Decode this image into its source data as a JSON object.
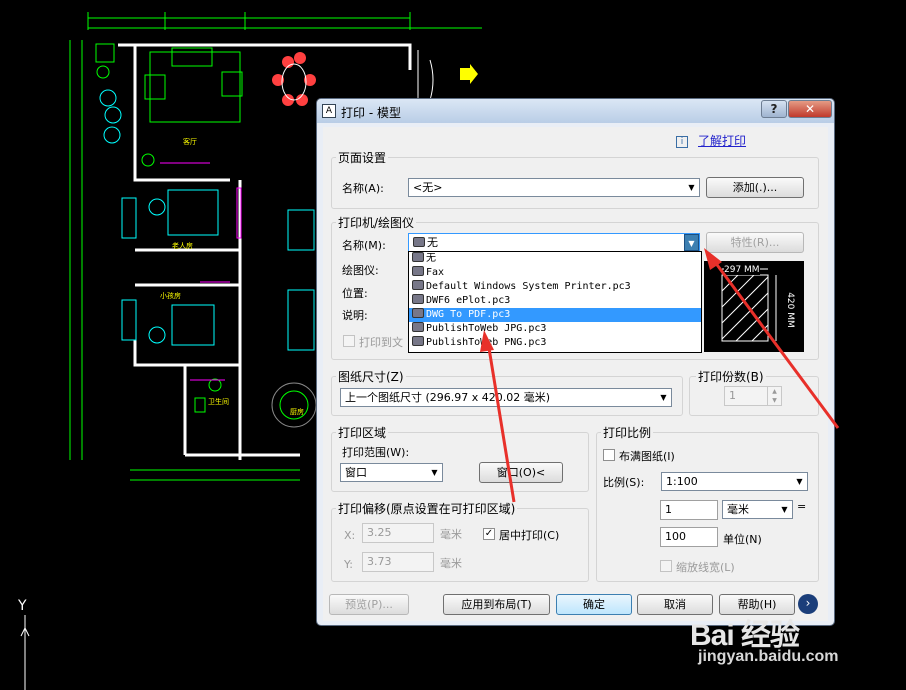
{
  "dialog": {
    "title": "打印 - 模型",
    "help_button": "?",
    "learn_link": "了解打印"
  },
  "page_setup": {
    "legend": "页面设置",
    "name_label": "名称(A):",
    "name_value": "<无>",
    "add_button": "添加(.)..."
  },
  "printer": {
    "legend": "打印机/绘图仪",
    "name_label": "名称(M):",
    "name_value": "无",
    "properties_button": "特性(R)...",
    "plotter_label": "绘图仪:",
    "location_label": "位置:",
    "description_label": "说明:",
    "print_to_file_label": "打印到文",
    "options": [
      {
        "label": "无",
        "selected": false
      },
      {
        "label": "Fax",
        "selected": false
      },
      {
        "label": "Default Windows System Printer.pc3",
        "selected": false
      },
      {
        "label": "DWF6 ePlot.pc3",
        "selected": false
      },
      {
        "label": "DWG To PDF.pc3",
        "selected": true
      },
      {
        "label": "PublishToWeb JPG.pc3",
        "selected": false
      },
      {
        "label": "PublishToWeb PNG.pc3",
        "selected": false
      }
    ],
    "preview_width": "297 MM",
    "preview_height": "420 MM"
  },
  "paper": {
    "legend": "图纸尺寸(Z)",
    "value": "上一个图纸尺寸  (296.97 x 420.02 毫米)"
  },
  "copies": {
    "legend": "打印份数(B)",
    "value": "1"
  },
  "area": {
    "legend": "打印区域",
    "range_label": "打印范围(W):",
    "range_value": "窗口",
    "window_button": "窗口(O)<"
  },
  "offset": {
    "legend": "打印偏移(原点设置在可打印区域)",
    "x_label": "X:",
    "x_value": "3.25",
    "x_unit": "毫米",
    "y_label": "Y:",
    "y_value": "3.73",
    "y_unit": "毫米",
    "center_label": "居中打印(C)",
    "center_checked": true
  },
  "scale": {
    "legend": "打印比例",
    "fit_label": "布满图纸(I)",
    "fit_checked": false,
    "scale_label": "比例(S):",
    "scale_value": "1:100",
    "value1": "1",
    "unit1": "毫米",
    "equals": "=",
    "value2": "100",
    "unit2": "单位(N)",
    "lineweight_label": "缩放线宽(L)"
  },
  "buttons": {
    "preview": "预览(P)...",
    "apply_layout": "应用到布局(T)",
    "ok": "确定",
    "cancel": "取消",
    "help": "帮助(H)",
    "expand": "›"
  },
  "cad_labels": {
    "living_room": "客厅",
    "master_bedroom": "老人房",
    "small_bedroom": "小孩房",
    "bathroom": "卫生间",
    "kitchen": "厨房",
    "axis_y": "Y"
  },
  "watermark": {
    "logo": "Bai 经验",
    "url": "jingyan.baidu.com"
  },
  "colors": {
    "cad_green": "#00ff00",
    "cad_cyan": "#00ffff",
    "cad_magenta": "#ff00ff",
    "cad_yellow": "#ffff00",
    "annotation_red": "#e8302a",
    "selection_blue": "#3399ff"
  }
}
